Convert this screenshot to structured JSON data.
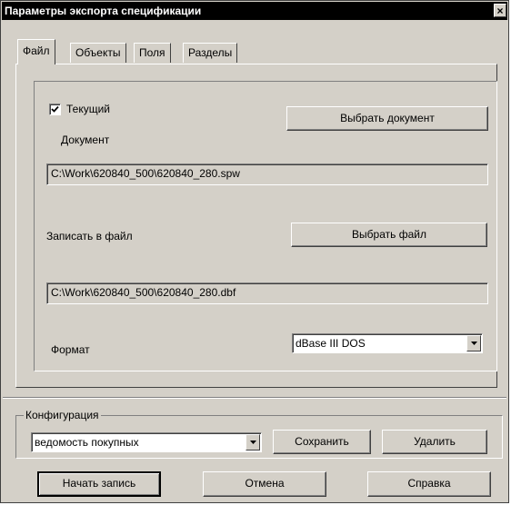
{
  "window": {
    "title": "Параметры экспорта спецификации",
    "close_glyph": "×"
  },
  "tabs": [
    {
      "label": "Файл",
      "active": true
    },
    {
      "label": "Объекты",
      "active": false
    },
    {
      "label": "Поля",
      "active": false
    },
    {
      "label": "Разделы",
      "active": false
    }
  ],
  "file_tab": {
    "current_checkbox": {
      "label": "Текущий",
      "checked": true
    },
    "document_label": "Документ",
    "select_document_button": "Выбрать документ",
    "document_path": "C:\\Work\\620840_500\\620840_280.spw",
    "write_to_file_label": "Записать в файл",
    "select_file_button": "Выбрать файл",
    "file_path": "C:\\Work\\620840_500\\620840_280.dbf",
    "format_label": "Формат",
    "format_value": "dBase III DOS"
  },
  "configuration": {
    "legend": "Конфигурация",
    "selected": "ведомость покупных",
    "save_button": "Сохранить",
    "delete_button": "Удалить"
  },
  "footer": {
    "start_button": "Начать запись",
    "cancel_button": "Отмена",
    "help_button": "Справка"
  }
}
